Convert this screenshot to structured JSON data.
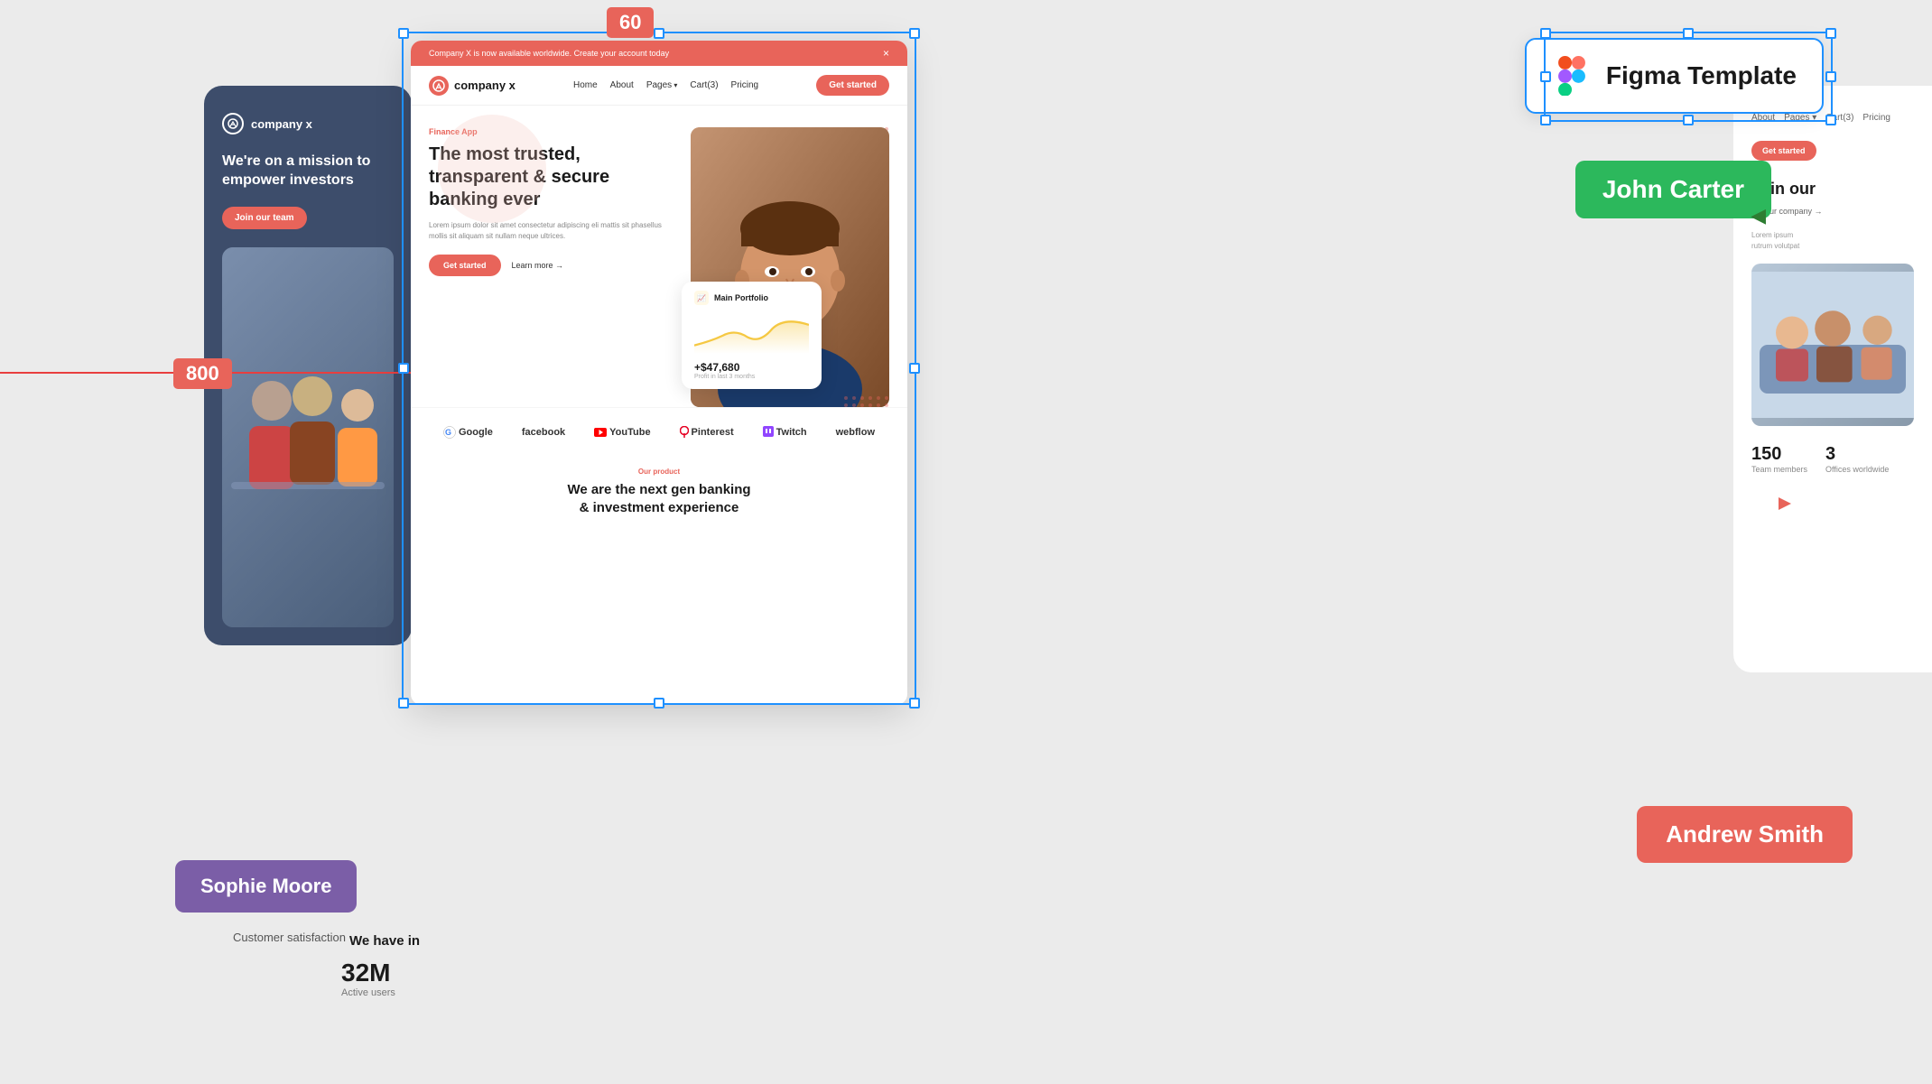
{
  "canvas": {
    "background_color": "#ebebeb"
  },
  "dim_label_60": "60",
  "dim_label_800": "800",
  "figma_badge": {
    "text": "Figma Template",
    "icon": "figma-icon"
  },
  "john_carter": {
    "name": "John Carter"
  },
  "andrew_smith": {
    "name": "Andrew Smith"
  },
  "sophie_moore": {
    "name": "Sophie Moore",
    "sub": "Customer satisfaction"
  },
  "left_card": {
    "logo": "company x",
    "headline": "We're on a mission to empower investors",
    "btn": "Join our team",
    "stats": [
      {
        "num": "32M",
        "label": "Active users"
      }
    ]
  },
  "main_mockup": {
    "notif_bar": {
      "text": "Company X is now available worldwide. Create your account today",
      "close": "×"
    },
    "nav": {
      "logo": "company x",
      "links": [
        {
          "label": "Home",
          "dropdown": false
        },
        {
          "label": "About",
          "dropdown": false
        },
        {
          "label": "Pages",
          "dropdown": true
        },
        {
          "label": "Cart(3)",
          "dropdown": false
        },
        {
          "label": "Pricing",
          "dropdown": false
        }
      ],
      "cta": "Get started"
    },
    "hero": {
      "tag": "Finance App",
      "title": "The most trusted, transparent & secure banking ever",
      "body": "Lorem ipsum dolor sit amet consectetur adipiscing eli mattis sit phasellus mollis sit aliquam sit nullam neque ultrices.",
      "btn_primary": "Get started",
      "btn_secondary": "Learn more →"
    },
    "portfolio_card": {
      "title": "Main Portfolio",
      "amount": "+$47,680",
      "sub": "Profit in last 3 months"
    },
    "logos": [
      {
        "name": "Google",
        "icon": "google-logo"
      },
      {
        "name": "facebook",
        "icon": "facebook-logo"
      },
      {
        "name": "YouTube",
        "icon": "youtube-logo"
      },
      {
        "name": "Pinterest",
        "icon": "pinterest-logo"
      },
      {
        "name": "Twitch",
        "icon": "twitch-logo"
      },
      {
        "name": "webflow",
        "icon": "webflow-logo"
      }
    ],
    "bottom": {
      "tag": "Our product",
      "headline": "We are the next gen banking\n& investment experience"
    }
  },
  "right_card": {
    "nav_links": [
      "About",
      "Pages",
      "Cart(3)",
      "Pricing",
      "Get started"
    ],
    "content": "Join our",
    "sub": "out our company →",
    "stats": [
      {
        "num": "150",
        "label": "Team members"
      },
      {
        "num": "3",
        "label": "Offices worldwide"
      }
    ]
  }
}
